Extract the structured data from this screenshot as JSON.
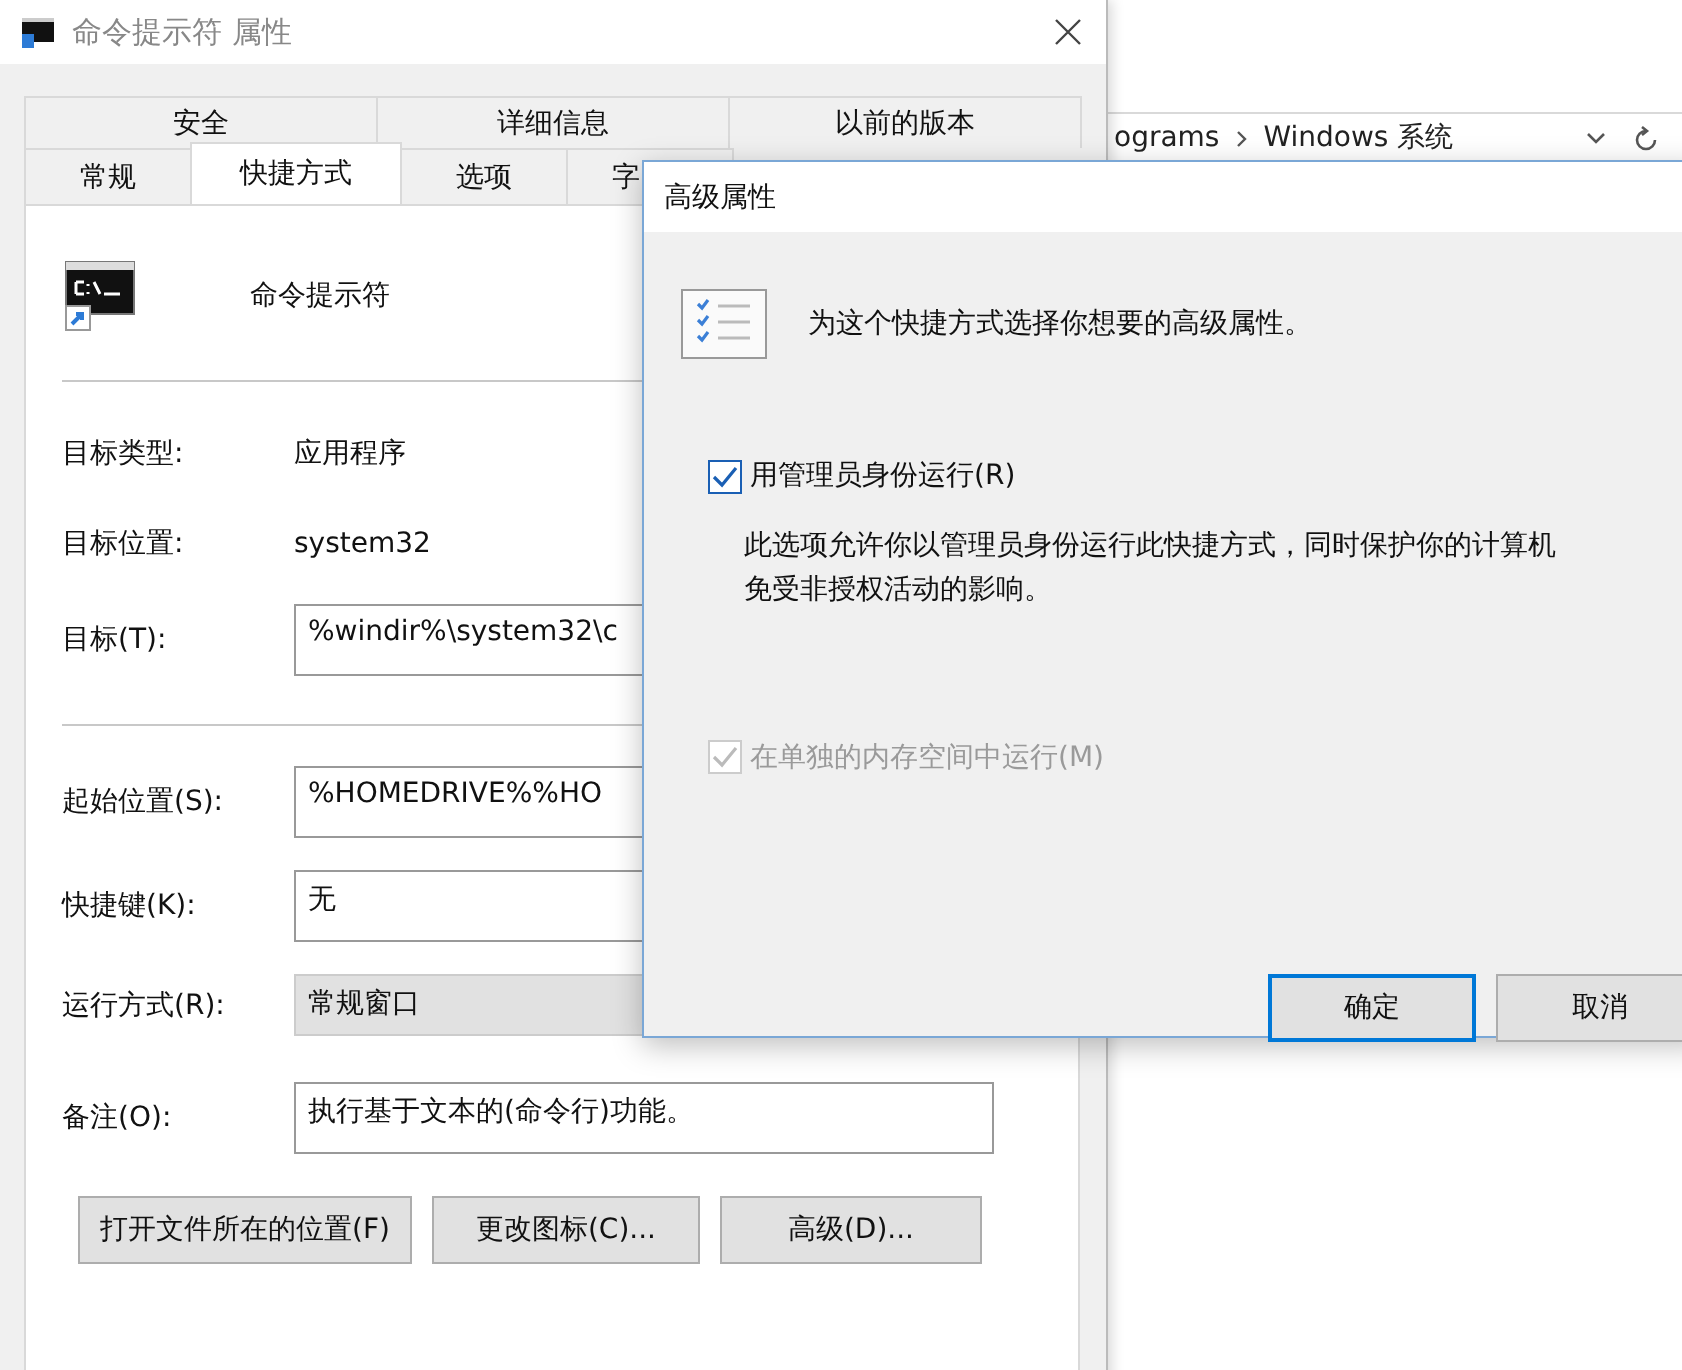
{
  "explorer": {
    "breadcrumb": [
      "ograms",
      "Windows 系统"
    ]
  },
  "properties_window": {
    "title": "命令提示符 属性",
    "tabs_row_1": [
      {
        "label": "安全",
        "selected": false
      },
      {
        "label": "详细信息",
        "selected": false
      },
      {
        "label": "以前的版本",
        "selected": false
      }
    ],
    "tabs_row_2": [
      {
        "label": "常规",
        "selected": false
      },
      {
        "label": "快捷方式",
        "selected": true
      },
      {
        "label": "选项",
        "selected": false
      },
      {
        "label": "字",
        "selected": false
      }
    ],
    "app_name": "命令提示符",
    "info": [
      {
        "label": "目标类型:",
        "value": "应用程序"
      },
      {
        "label": "目标位置:",
        "value": "system32"
      }
    ],
    "target": {
      "label": "目标(T):",
      "value": "%windir%\\system32\\c"
    },
    "fields": [
      {
        "label": "起始位置(S):",
        "value": "%HOMEDRIVE%%HO",
        "kind": "text"
      },
      {
        "label": "快捷键(K):",
        "value": "无",
        "kind": "text"
      },
      {
        "label": "运行方式(R):",
        "value": "常规窗口",
        "kind": "dropdown"
      },
      {
        "label": "备注(O):",
        "value": "执行基于文本的(命令行)功能。",
        "kind": "text"
      }
    ],
    "buttons": [
      "打开文件所在的位置(F)",
      "更改图标(C)...",
      "高级(D)..."
    ]
  },
  "dialog": {
    "title": "高级属性",
    "heading": "为这个快捷方式选择你想要的高级属性。",
    "options": [
      {
        "label": "用管理员身份运行(R)",
        "checked": true,
        "disabled": false,
        "description": "此选项允许你以管理员身份运行此快捷方式，同时保护你的计算机免受非授权活动的影响。"
      },
      {
        "label": "在单独的内存空间中运行(M)",
        "checked": true,
        "disabled": true
      }
    ],
    "buttons": [
      {
        "label": "确定",
        "default": true
      },
      {
        "label": "取消",
        "default": false
      }
    ]
  }
}
